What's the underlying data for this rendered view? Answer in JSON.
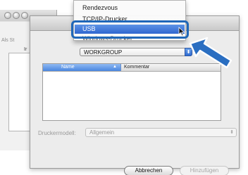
{
  "back_window": {
    "label": "Als St",
    "column": "Ir"
  },
  "dialog": {
    "workgroup_value": "WORKGROUP",
    "list": {
      "col_name": "Name",
      "col_comment": "Kommentar"
    },
    "driver_label": "Druckermodell:",
    "driver_value": "Allgemein",
    "cancel_label": "Abbrechen",
    "add_label": "Hinzufügen"
  },
  "popup_menu": {
    "items": [
      "Rendezvous",
      "TCP/IP-Drucker",
      "USB",
      "Windows-Drucker"
    ],
    "selected": "USB"
  },
  "colors": {
    "highlight": "#1f67b8",
    "selection": "#2f66cf",
    "callout_arrow": "#2a6ec1"
  },
  "icons": [
    "sort-ascending-icon",
    "select-arrows-icon",
    "pointer-cursor-icon",
    "callout-arrow-icon"
  ]
}
